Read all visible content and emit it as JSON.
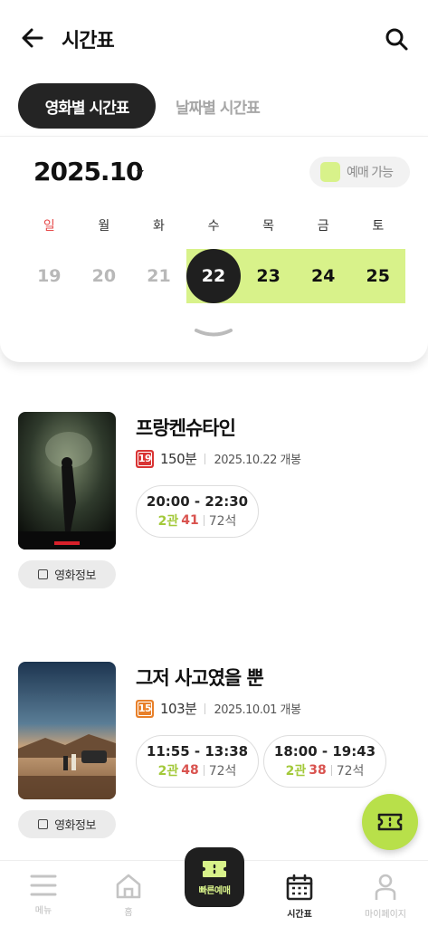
{
  "header": {
    "title": "시간표"
  },
  "tabs": [
    {
      "label": "영화별 시간표",
      "active": true
    },
    {
      "label": "날짜별 시간표",
      "active": false
    }
  ],
  "calendar": {
    "month": "2025.10",
    "legend_label": "예매 가능",
    "available_color": "#d8f28a",
    "weekdays": [
      "일",
      "월",
      "화",
      "수",
      "목",
      "금",
      "토"
    ],
    "dates": [
      "19",
      "20",
      "21",
      "22",
      "23",
      "24",
      "25"
    ],
    "selected_date": "22"
  },
  "movies": [
    {
      "title": "프랑켄슈타인",
      "rating": "19",
      "rating_color": "#d93434",
      "runtime": "150분",
      "release": "2025.10.22 개봉",
      "info_label": "영화정보",
      "showtimes": [
        {
          "range": "20:00 - 22:30",
          "hall": "2관",
          "remaining": "41",
          "total": "72석"
        }
      ]
    },
    {
      "title": "그저 사고였을 뿐",
      "rating": "15",
      "rating_color": "#e8802a",
      "runtime": "103분",
      "release": "2025.10.01 개봉",
      "info_label": "영화정보",
      "showtimes": [
        {
          "range": "11:55 - 13:38",
          "hall": "2관",
          "remaining": "48",
          "total": "72석"
        },
        {
          "range": "18:00 - 19:43",
          "hall": "2관",
          "remaining": "38",
          "total": "72석"
        }
      ]
    }
  ],
  "bottom_nav": {
    "menu": "메뉴",
    "home": "홈",
    "quick": "빠른예매",
    "schedule": "시간표",
    "mypage": "마이페이지"
  }
}
